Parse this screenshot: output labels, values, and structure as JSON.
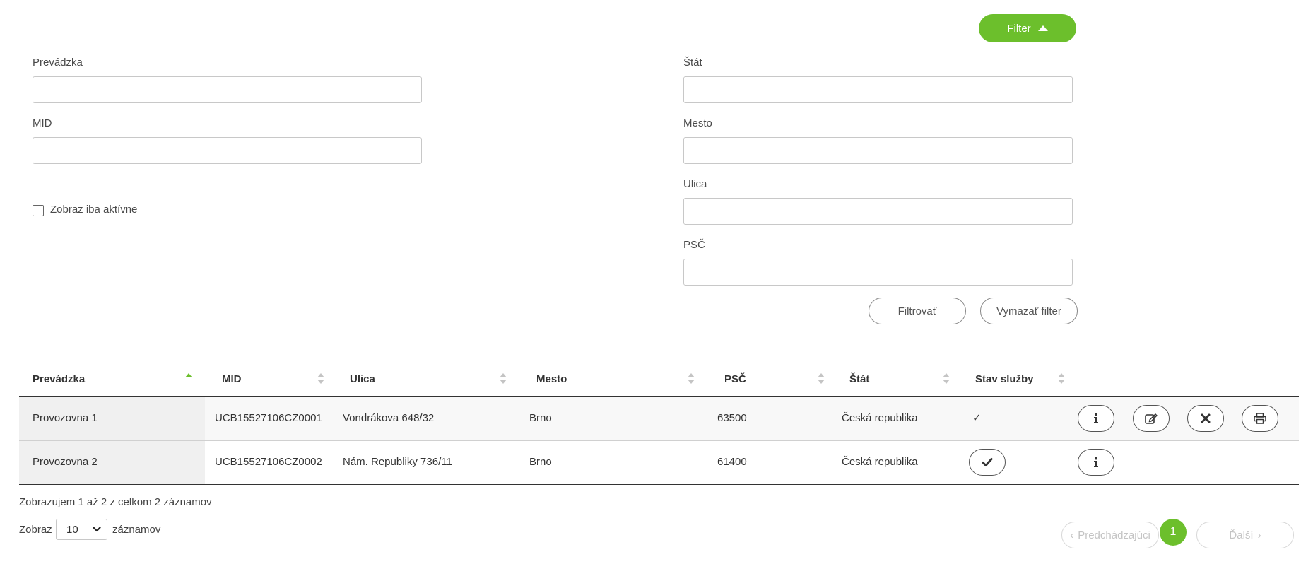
{
  "filter": {
    "toggle_label": "Filter",
    "fields": {
      "prevadzka": {
        "label": "Prevádzka",
        "value": "",
        "placeholder": ""
      },
      "mid": {
        "label": "MID",
        "value": "",
        "placeholder": ""
      },
      "stat": {
        "label": "Štát",
        "value": "",
        "placeholder": ""
      },
      "mesto": {
        "label": "Mesto",
        "value": "",
        "placeholder": ""
      },
      "ulica": {
        "label": "Ulica",
        "value": "",
        "placeholder": ""
      },
      "psc": {
        "label": "PSČ",
        "value": "",
        "placeholder": ""
      }
    },
    "active_only_label": "Zobraz iba aktívne",
    "active_only_checked": false,
    "apply_label": "Filtrovať",
    "clear_label": "Vymazať filter"
  },
  "table": {
    "columns": [
      "Prevádzka",
      "MID",
      "Ulica",
      "Mesto",
      "PSČ",
      "Štát",
      "Stav služby"
    ],
    "sorted_column": "Prevádzka",
    "sort_direction": "asc",
    "rows": [
      {
        "prevadzka": "Provozovna 1",
        "mid": "UCB15527106CZ0001",
        "ulica": "Vondrákova 648/32",
        "mesto": "Brno",
        "psc": "63500",
        "stat": "Česká republika",
        "stav": "✓",
        "actions": [
          "info-icon",
          "edit-icon",
          "close-icon",
          "print-icon"
        ]
      },
      {
        "prevadzka": "Provozovna 2",
        "mid": "UCB15527106CZ0002",
        "ulica": "Nám. Republiky 736/11",
        "mesto": "Brno",
        "psc": "61400",
        "stat": "Česká republika",
        "stav": "",
        "actions": [
          "check-icon",
          "info-icon"
        ]
      }
    ]
  },
  "footer": {
    "info_text": "Zobrazujem 1 až 2 z celkom 2 záznamov",
    "length_prefix": "Zobraz",
    "length_value": "10",
    "length_suffix": "záznamov",
    "prev_label": "Predchádzajúci",
    "next_label": "Ďalší",
    "current_page": "1"
  },
  "colors": {
    "accent": "#6cbf2c",
    "row_highlight": "#f0f0f0",
    "text": "#333333"
  }
}
